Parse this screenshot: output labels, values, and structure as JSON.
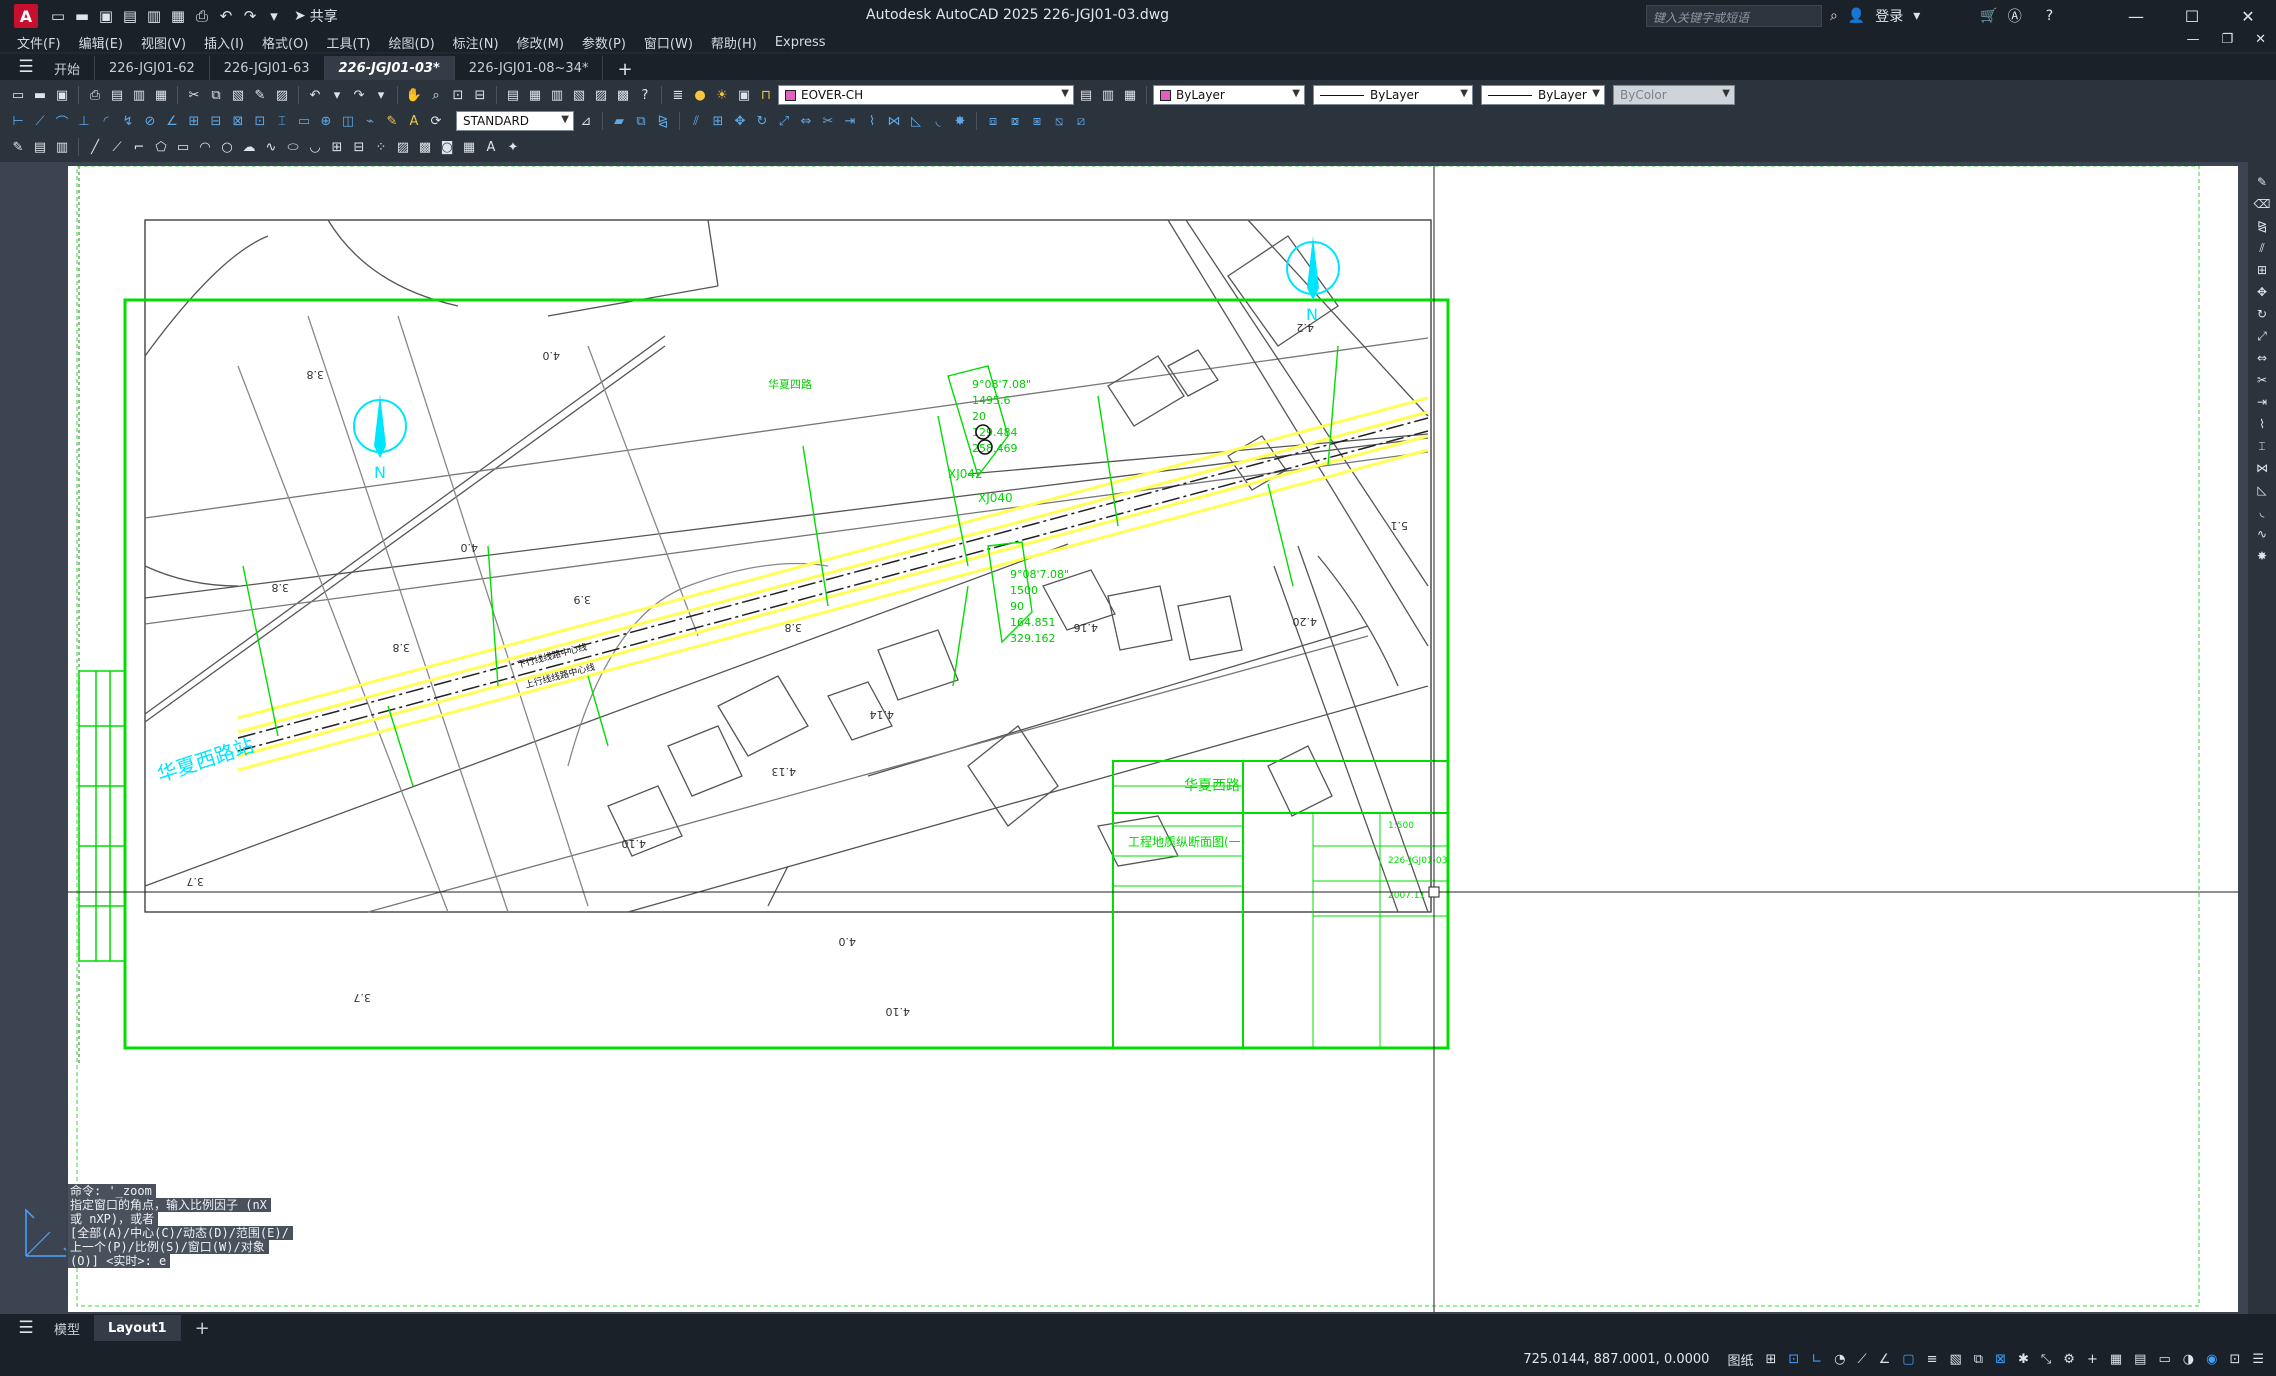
{
  "app": {
    "title": "Autodesk AutoCAD 2025    226-JGJ01-03.dwg",
    "logo": "A",
    "share_label": "共享",
    "search_placeholder": "键入关键字或短语",
    "login_label": "登录"
  },
  "menu": [
    "文件(F)",
    "编辑(E)",
    "视图(V)",
    "插入(I)",
    "格式(O)",
    "工具(T)",
    "绘图(D)",
    "标注(N)",
    "修改(M)",
    "参数(P)",
    "窗口(W)",
    "帮助(H)",
    "Express"
  ],
  "file_tabs": [
    {
      "label": "开始",
      "active": false
    },
    {
      "label": "226-JGJ01-62",
      "active": false
    },
    {
      "label": "226-JGJ01-63",
      "active": false
    },
    {
      "label": "226-JGJ01-03*",
      "active": true
    },
    {
      "label": "226-JGJ01-08~34*",
      "active": false
    }
  ],
  "properties": {
    "layer": "EOVER-CH",
    "color": "ByLayer",
    "linetype": "ByLayer",
    "lineweight": "ByLayer",
    "plotstyle": "ByColor",
    "textstyle": "STANDARD"
  },
  "command_line": [
    "命令:  '_zoom",
    "指定窗口的角点，输入比例因子 (nX",
    "或 nXP)，或者",
    "[全部(A)/中心(C)/动态(D)/范围(E)/",
    "上一个(P)/比例(S)/窗口(W)/对象",
    "(O)] <实时>: e"
  ],
  "layout_tabs": [
    {
      "label": "模型",
      "active": false
    },
    {
      "label": "Layout1",
      "active": true
    }
  ],
  "status": {
    "coordinates": "725.0144, 887.0001, 0.0000",
    "space": "图纸"
  },
  "drawing": {
    "north_label": "N",
    "station_label": "华夏西路站",
    "road_label": "华夏四路",
    "track_up": "上行线线路中心线",
    "track_down": "下行线线路中心线",
    "curve_points": [
      "XJ042",
      "XJ040"
    ],
    "curve_table_1": {
      "a": "9°08'7.08\"",
      "R": "1495.6",
      "l": "20",
      "T": "129.484",
      "L": "258.469"
    },
    "curve_table_2": {
      "a": "9°08'7.08\"",
      "R": "1500",
      "l": "90",
      "T": "164.851",
      "L": "329.162"
    },
    "elevations": [
      "4.0",
      "3.8",
      "4.0",
      "3.9",
      "3.8",
      "3.8",
      "3.8",
      "4.16",
      "4.20",
      "4.14",
      "4.13",
      "4.10",
      "3.7",
      "3.7",
      "4.0",
      "4.10",
      "5.1",
      "4.2"
    ],
    "titleblock": {
      "project": "华夏西路",
      "drawing_name": "工程地质纵断面图(一)",
      "scale": "1:500",
      "drawing_no": "226-JGJ01-03",
      "date": "2007.11"
    },
    "colors": {
      "frame": "#00dd00",
      "track": "#ffff55",
      "annotation": "#00e5ff",
      "base": "#555555"
    }
  }
}
